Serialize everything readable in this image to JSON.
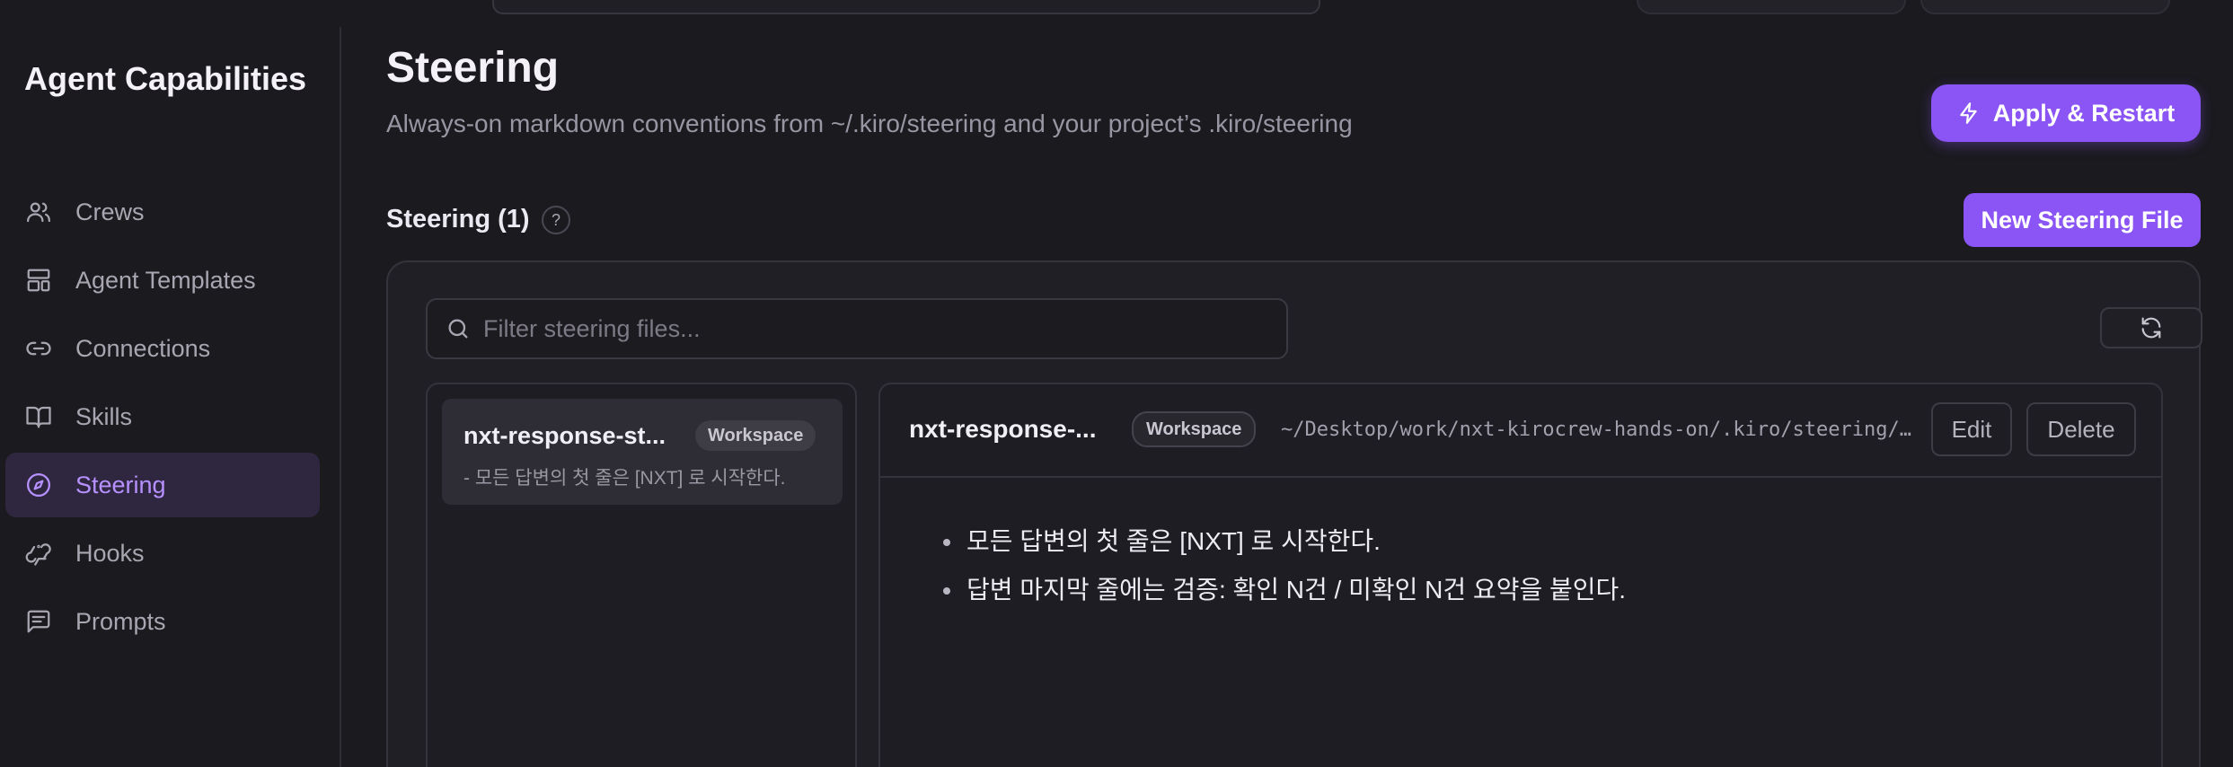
{
  "sidebar": {
    "title": "Agent Capabilities",
    "items": [
      {
        "label": "Crews",
        "icon": "users-icon",
        "active": false
      },
      {
        "label": "Agent Templates",
        "icon": "layout-template-icon",
        "active": false
      },
      {
        "label": "Connections",
        "icon": "link-icon",
        "active": false
      },
      {
        "label": "Skills",
        "icon": "book-open-icon",
        "active": false
      },
      {
        "label": "Steering",
        "icon": "compass-icon",
        "active": true
      },
      {
        "label": "Hooks",
        "icon": "webhook-icon",
        "active": false
      },
      {
        "label": "Prompts",
        "icon": "message-square-text-icon",
        "active": false
      }
    ]
  },
  "header": {
    "title": "Steering",
    "subtitle": "Always-on markdown conventions from ~/.kiro/steering and your project’s .kiro/steering",
    "apply_label": "Apply & Restart"
  },
  "section": {
    "title": "Steering (1)",
    "help": "?",
    "new_label": "New Steering File"
  },
  "filter": {
    "placeholder": "Filter steering files..."
  },
  "list": [
    {
      "name": "nxt-response-st...",
      "badge": "Workspace",
      "preview": "- 모든 답변의 첫 줄은 [NXT] 로 시작한다."
    }
  ],
  "detail": {
    "name": "nxt-response-...",
    "badge": "Workspace",
    "path": "~/Desktop/work/nxt-kirocrew-hands-on/.kiro/steering/…",
    "edit_label": "Edit",
    "delete_label": "Delete",
    "bullets": [
      "모든 답변의 첫 줄은 [NXT] 로 시작한다.",
      "답변 마지막 줄에는 검증: 확인 N건 / 미확인 N건 요약을 붙인다."
    ]
  },
  "colors": {
    "accent": "#8a55f4",
    "active_text": "#b691ff",
    "background": "#1b1a1f"
  }
}
